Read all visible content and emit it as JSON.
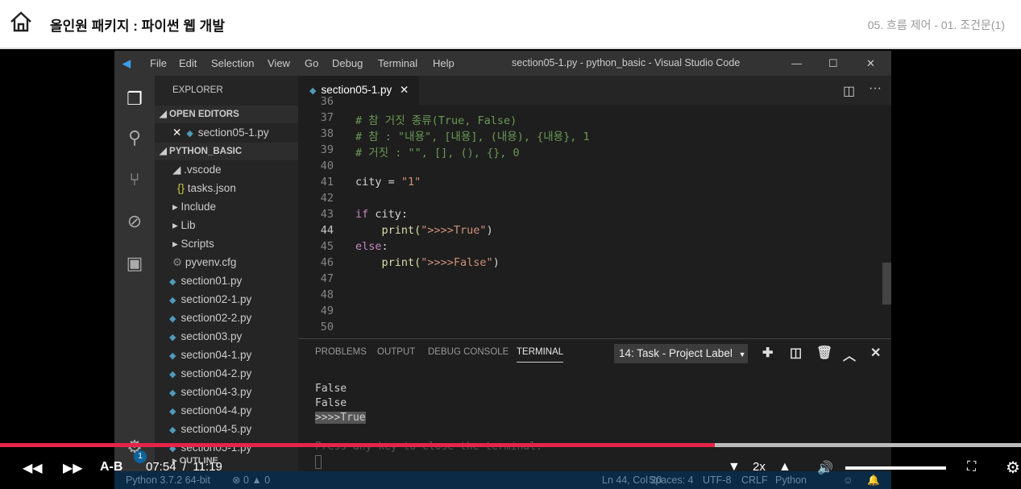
{
  "header": {
    "title": "올인원 패키지 : 파이썬 웹 개발",
    "breadcrumb": "05. 흐름 제어 - 01. 조건문(1)"
  },
  "vscode": {
    "menu": [
      "File",
      "Edit",
      "Selection",
      "View",
      "Go",
      "Debug",
      "Terminal",
      "Help"
    ],
    "window_title": "section05-1.py - python_basic - Visual Studio Code",
    "explorer_title": "EXPLORER",
    "open_editors": "OPEN EDITORS",
    "open_file": "section05-1.py",
    "project": "PYTHON_BASIC",
    "tree": [
      ".vscode",
      "tasks.json",
      "Include",
      "Lib",
      "Scripts",
      "pyvenv.cfg",
      "section01.py",
      "section02-1.py",
      "section02-2.py",
      "section03.py",
      "section04-1.py",
      "section04-2.py",
      "section04-3.py",
      "section04-4.py",
      "section04-5.py",
      "section05-1.py"
    ],
    "outline": "OUTLINE",
    "tab": "section05-1.py",
    "lines": [
      {
        "n": "36",
        "t": ""
      },
      {
        "n": "37",
        "t": "# 참 거짓 종류(True, False)"
      },
      {
        "n": "38",
        "t": "# 참 : \"내용\", [내용], (내용), {내용}, 1"
      },
      {
        "n": "39",
        "t": "# 거짓 : \"\", [], (), {}, 0"
      },
      {
        "n": "40",
        "t": ""
      },
      {
        "n": "41",
        "a": "city = ",
        "b": "\"1\""
      },
      {
        "n": "42",
        "t": ""
      },
      {
        "n": "43",
        "a": "if",
        "b": " city:"
      },
      {
        "n": "44",
        "a": "    print(",
        "b": "\">>>>True\"",
        "c": ")"
      },
      {
        "n": "45",
        "a": "else",
        "b": ":"
      },
      {
        "n": "46",
        "a": "    print(",
        "b": "\">>>>False\"",
        "c": ")"
      },
      {
        "n": "47",
        "t": ""
      },
      {
        "n": "48",
        "t": ""
      },
      {
        "n": "49",
        "t": ""
      },
      {
        "n": "50",
        "t": ""
      }
    ],
    "panel_tabs": [
      "PROBLEMS",
      "OUTPUT",
      "DEBUG CONSOLE",
      "TERMINAL"
    ],
    "terminal_select": "14: Task - Project Label",
    "terminal": [
      "False",
      "False",
      ">>>>True",
      "",
      "Press any key to close the terminal."
    ],
    "status_left": "Python 3.7.2 64-bit",
    "errors": "0",
    "warnings": "0",
    "status_right": [
      "Ln 44, Col 20",
      "Spaces: 4",
      "UTF-8",
      "CRLF",
      "Python"
    ],
    "badge": "1"
  },
  "player": {
    "ab": "A-B",
    "current": "07:54",
    "sep": "/",
    "total": "11:19",
    "speed": "2x",
    "progress_percent": 70,
    "volume_percent": 100,
    "accent": "#e8234a"
  }
}
